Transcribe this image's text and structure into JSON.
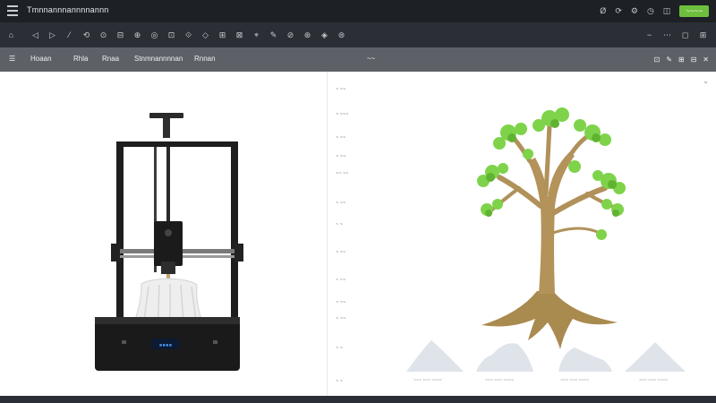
{
  "window": {
    "title": "Tmnnannnannnnannn",
    "right_icons": [
      "Ø",
      "⟳",
      "⚙",
      "◷",
      "◫"
    ],
    "primary_action": "~~~~"
  },
  "toolbar": {
    "left_tools": [
      "⌂",
      "◁",
      "▷",
      "⁄",
      "⟲",
      "⊙",
      "⊟",
      "⊕",
      "◎",
      "⊡",
      "⟐",
      "◇",
      "⊞",
      "⊠",
      "⌖",
      "✎",
      "⊘",
      "⊛",
      "◈",
      "⊜"
    ],
    "right_tools": [
      "−",
      "⋯",
      "◻",
      "⊞"
    ]
  },
  "subbar": {
    "items": [
      "☰",
      "Hoaan",
      "Rhla",
      "Rnaa",
      "Stnmnannnnan",
      "Rnnan",
      "~~"
    ],
    "right_icons": [
      "⊡",
      "✎",
      "⊞",
      "⊟",
      "✕"
    ]
  },
  "properties": [
    "~ ~~",
    "~ ~~~",
    "~ ~~",
    "~ ~~",
    "~~ ~~",
    "~ ~~",
    "~ ~",
    "~ ~~",
    "~ ~~",
    "~ ~~",
    "~ ~~",
    "~ ~",
    "~ ~"
  ],
  "preview": {
    "collapse_icon": "⌄",
    "thumbnails": [
      {
        "label": "~~~ ~~~ ~~~~"
      },
      {
        "label": "~~~ ~~~ ~~~~"
      },
      {
        "label": "~~~ ~~~ ~~~~"
      },
      {
        "label": "~~~ ~~~ ~~~~"
      }
    ]
  },
  "printer_display": "▪▪▪▪"
}
